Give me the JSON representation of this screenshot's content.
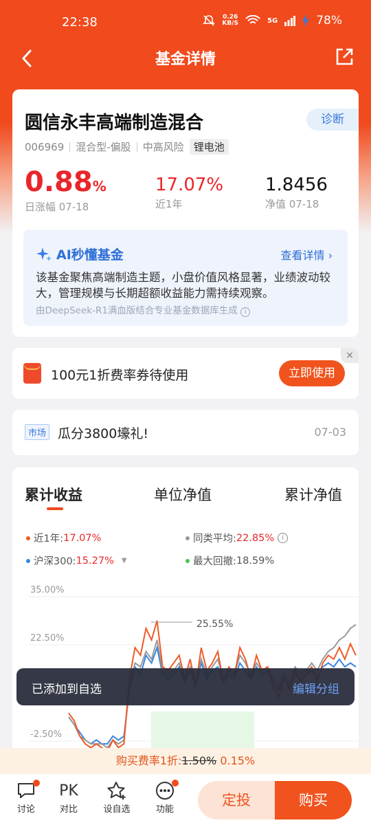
{
  "status": {
    "time": "22:38",
    "speed_value": "0.26",
    "speed_unit": "KB/S",
    "net": "5G",
    "battery": "78%"
  },
  "nav": {
    "title": "基金详情"
  },
  "fund": {
    "name": "圆信永丰高端制造混合",
    "diagnose_label": "诊断",
    "code": "006969",
    "type": "混合型-偏股",
    "risk": "中高风险",
    "theme_tag": "锂电池",
    "daily_change": "0.88",
    "daily_change_unit": "%",
    "daily_change_label": "日涨幅 07-18",
    "year_return": "17.07%",
    "year_return_label": "近1年",
    "nav_value": "1.8456",
    "nav_label": "净值 07-18"
  },
  "ai": {
    "title": "AI秒懂基金",
    "more": "查看详情",
    "text": "该基金聚焦高端制造主题，小盘价值风格显著，业绩波动较大，管理规模与长期超额收益能力需持续观察。",
    "source": "由DeepSeek-R1满血版结合专业基金数据库生成"
  },
  "coupon": {
    "text": "100元1折费率券待使用",
    "button": "立即使用",
    "close": "×"
  },
  "news": {
    "tag": "市场",
    "title": "瓜分3800壕礼!",
    "date": "07-03"
  },
  "chart_tabs": [
    "累计收益",
    "单位净值",
    "累计净值"
  ],
  "legend": {
    "year_label": "近1年:",
    "year_value": "17.07%",
    "peer_label": "同类平均:",
    "peer_value": "22.85%",
    "index_label": "沪深300:",
    "index_value": "15.27%",
    "drawdown_label": "最大回撤:",
    "drawdown_value": "18.59%"
  },
  "colors": {
    "fund": "#f05a28",
    "peer": "#9a9a9a",
    "index": "#3a86e0",
    "drawdown": "#4cbf56",
    "accent": "#f0531d"
  },
  "chart_data": {
    "type": "line",
    "y_tick_labels": [
      "35.00%",
      "22.50%",
      "-2.50%"
    ],
    "ylim": [
      -2.5,
      35
    ],
    "annotations": [
      "25.55%"
    ],
    "series": [
      {
        "name": "近1年",
        "values": [
          3,
          1,
          -3,
          -5,
          -6,
          -5,
          -6,
          -7,
          -4,
          -6,
          -5,
          12,
          20,
          18,
          25,
          22,
          27,
          15,
          14,
          16,
          18,
          12,
          17,
          10,
          20,
          14,
          16,
          19,
          11,
          15,
          13,
          20,
          17,
          12,
          18,
          14,
          15,
          10,
          7,
          12,
          9,
          14,
          11,
          13,
          15,
          11,
          16,
          18,
          17,
          20,
          17,
          21,
          18
        ]
      },
      {
        "name": "同类平均",
        "values": [
          2,
          0,
          -3,
          -4,
          -5,
          -5,
          -5,
          -6,
          -4,
          -5,
          -4,
          10,
          16,
          15,
          19,
          17,
          22,
          14,
          13,
          14,
          16,
          12,
          15,
          11,
          17,
          13,
          15,
          17,
          12,
          14,
          13,
          18,
          16,
          13,
          16,
          14,
          15,
          12,
          10,
          13,
          11,
          15,
          13,
          14,
          16,
          14,
          17,
          19,
          20,
          22,
          23,
          25,
          26
        ]
      },
      {
        "name": "沪深300",
        "values": [
          2,
          0,
          -2,
          -4,
          -5,
          -4,
          -5,
          -5,
          -3,
          -4,
          -3,
          9,
          15,
          13,
          18,
          16,
          20,
          13,
          12,
          13,
          15,
          11,
          14,
          10,
          16,
          12,
          14,
          15,
          11,
          13,
          12,
          16,
          14,
          12,
          15,
          13,
          14,
          11,
          9,
          12,
          10,
          13,
          12,
          13,
          14,
          12,
          15,
          16,
          15,
          17,
          15,
          16,
          15
        ]
      }
    ]
  },
  "toast": {
    "text": "已添加到自选",
    "action": "编辑分组"
  },
  "fee": {
    "prefix": "购买费率1折:",
    "old": "1.50%",
    "new": "0.15%"
  },
  "bottom": {
    "discuss": "讨论",
    "compare_icon": "PK",
    "compare": "对比",
    "watchlist": "设自选",
    "features": "功能",
    "fixed": "定投",
    "buy": "购买"
  }
}
